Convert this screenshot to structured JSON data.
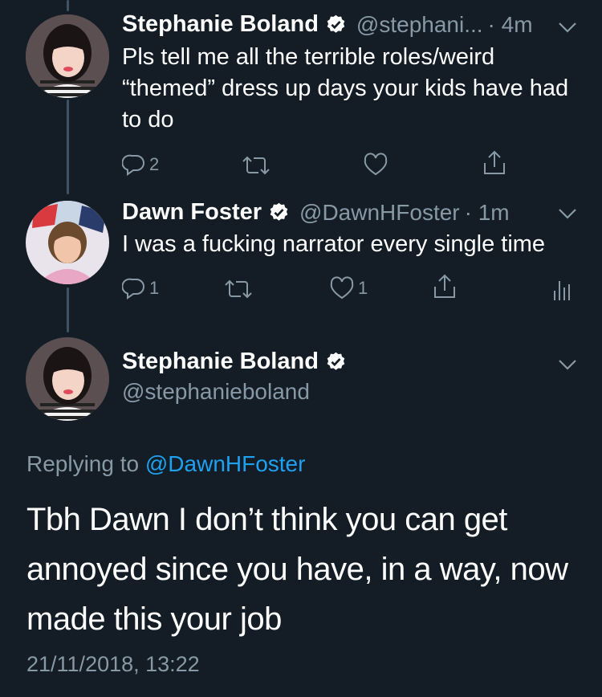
{
  "tweets": [
    {
      "name": "Stephanie Boland",
      "handle": "@stephani...",
      "time": "· 4m",
      "text": "Pls tell me all the terrible roles/weird “themed” dress up days your kids have had to do",
      "reply_count": "2",
      "retweet_count": "",
      "like_count": ""
    },
    {
      "name": "Dawn Foster",
      "handle": "@DawnHFoster",
      "time": "· 1m",
      "text": "I was a fucking narrator every single time",
      "reply_count": "1",
      "retweet_count": "",
      "like_count": "1"
    }
  ],
  "main_tweet": {
    "name": "Stephanie Boland",
    "handle": "@stephanieboland",
    "replying_prefix": "Replying to",
    "replying_to": "@DawnHFoster",
    "text": "Tbh Dawn I don’t think you can get annoyed since you have, in a way, now made this your job",
    "timestamp": "21/11/2018, 13:22"
  },
  "colors": {
    "background": "#141d26",
    "secondary_text": "#8899a6",
    "link": "#1da1f2",
    "thread_line": "#3d5466"
  },
  "icons": [
    "verified-badge-icon",
    "chevron-down-icon",
    "reply-icon",
    "retweet-icon",
    "like-icon",
    "share-icon",
    "analytics-icon"
  ]
}
